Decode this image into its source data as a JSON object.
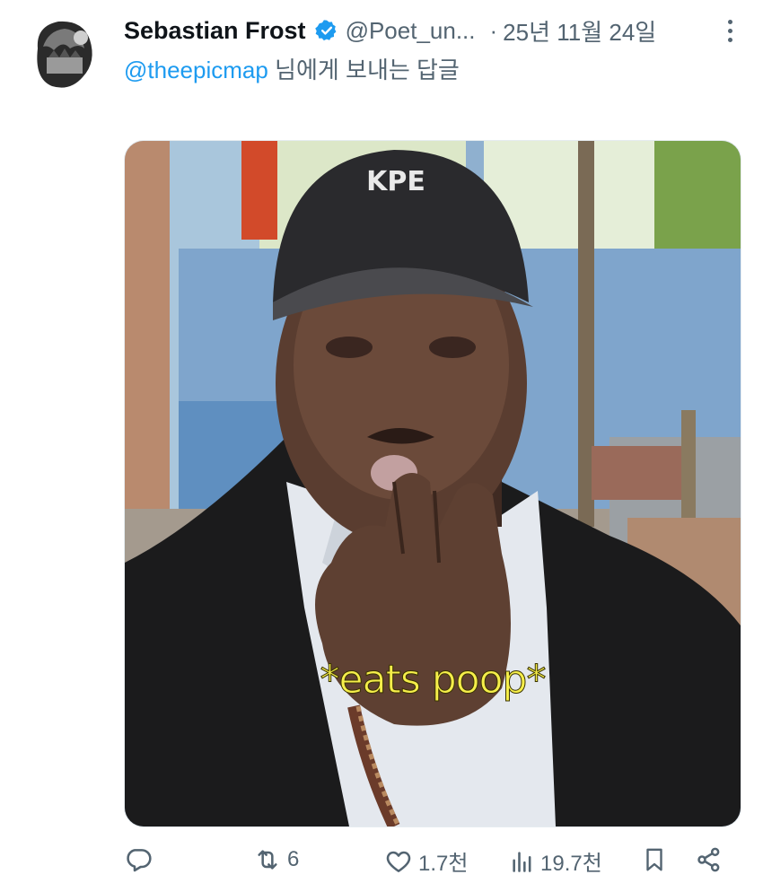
{
  "post": {
    "author_name": "Sebastian Frost",
    "handle": "@Poet_un...",
    "separator": "·",
    "date": "25년 11월 24일",
    "reply_to_handle": "@theepicmap",
    "reply_suffix": " 님에게 보내는 답글",
    "media_caption": "*eats poop*"
  },
  "actions": {
    "reply_count": "",
    "repost_count": "6",
    "like_count": "1.7천",
    "view_count": "19.7천"
  },
  "colors": {
    "link": "#1d9bf0",
    "muted": "#536471",
    "verified": "#1d9bf0"
  },
  "icons": [
    "more-icon",
    "verified-badge-icon",
    "reply-icon",
    "repost-icon",
    "like-icon",
    "views-icon",
    "bookmark-icon",
    "share-icon"
  ]
}
